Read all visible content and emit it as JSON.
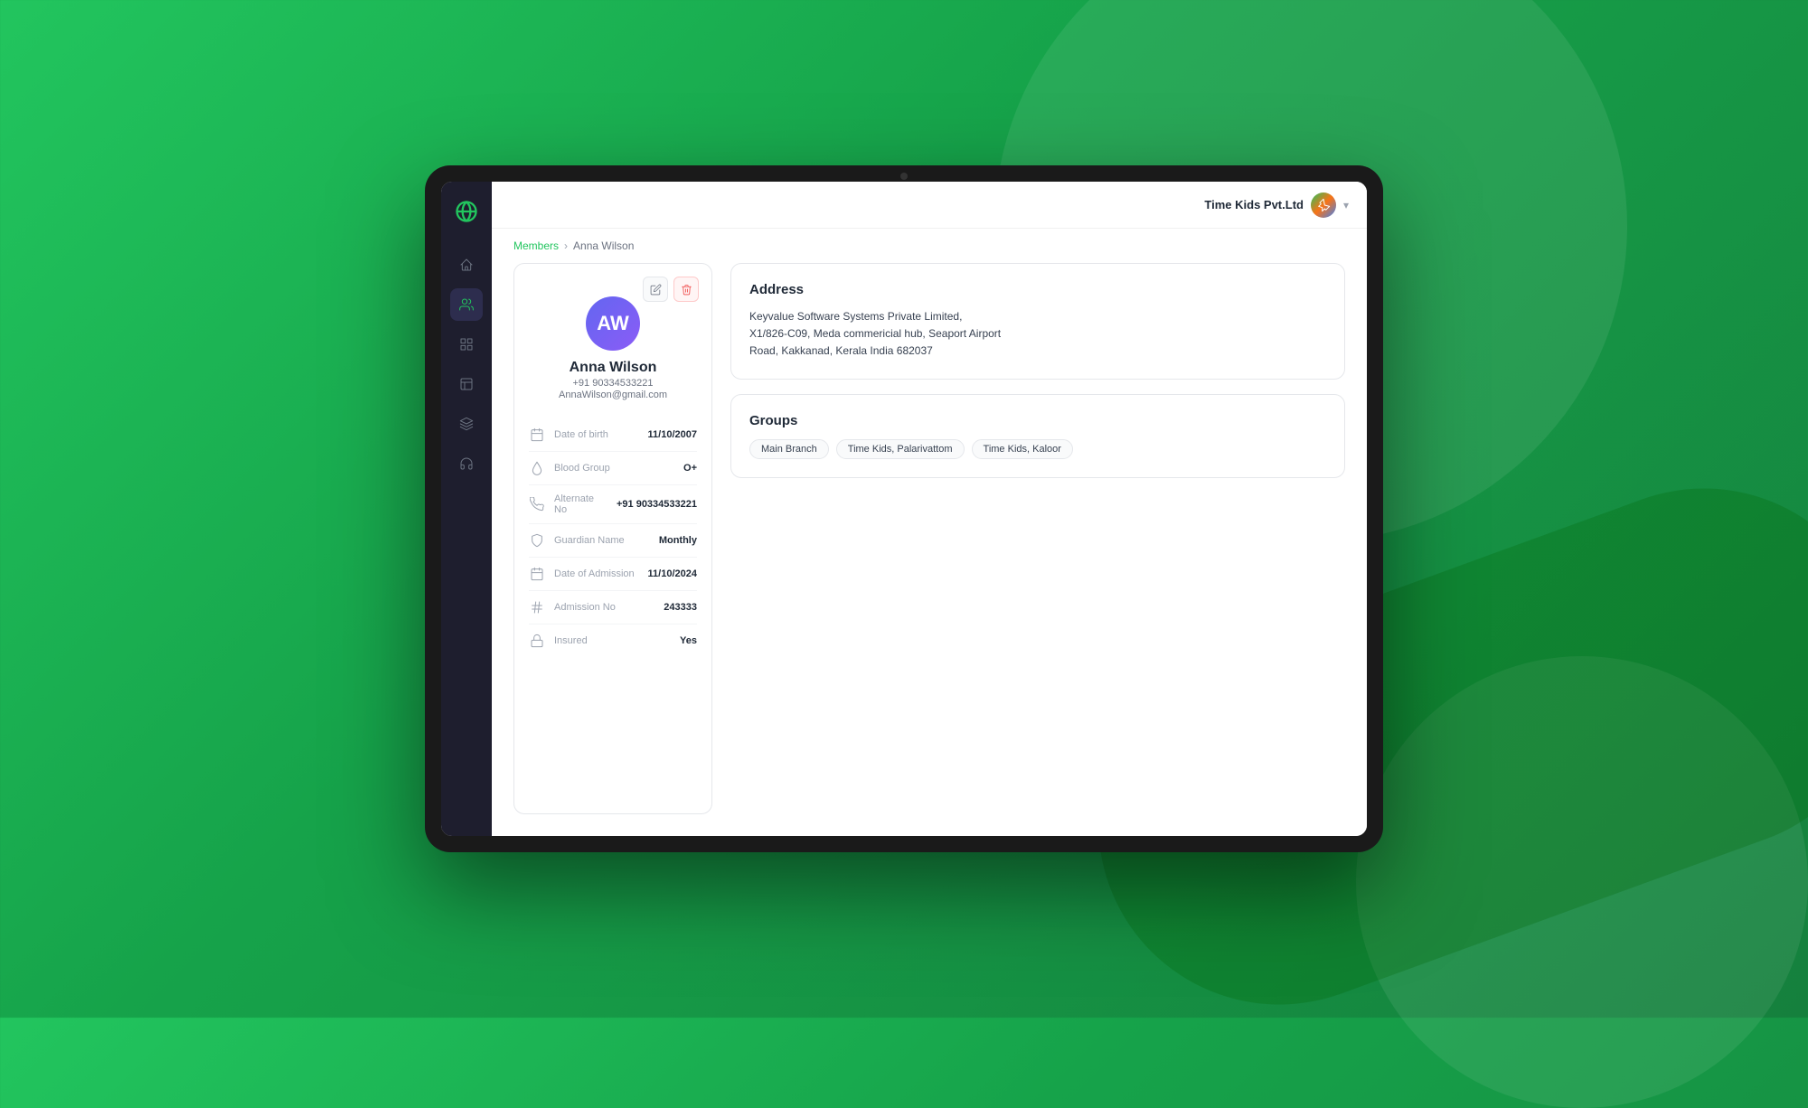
{
  "app": {
    "org_name": "Time Kids Pvt.Ltd"
  },
  "breadcrumb": {
    "parent": "Members",
    "separator": ">",
    "current": "Anna Wilson"
  },
  "profile": {
    "name": "Anna Wilson",
    "phone": "+91 90334533221",
    "email": "AnnaWilson@gmail.com",
    "edit_label": "✏",
    "delete_label": "🗑",
    "initials": "AW"
  },
  "info_fields": [
    {
      "icon": "calendar",
      "label": "Date of birth",
      "value": "11/10/2007"
    },
    {
      "icon": "blood",
      "label": "Blood Group",
      "value": "O+"
    },
    {
      "icon": "phone",
      "label": "Alternate No",
      "value": "+91 90334533221"
    },
    {
      "icon": "shield",
      "label": "Guardian Name",
      "value": "Monthly"
    },
    {
      "icon": "calendar2",
      "label": "Date of Admission",
      "value": "11/10/2024"
    },
    {
      "icon": "hash",
      "label": "Admission No",
      "value": "243333"
    },
    {
      "icon": "lock",
      "label": "Insured",
      "value": "Yes"
    }
  ],
  "address": {
    "title": "Address",
    "line1": "Keyvalue Software Systems Private Limited,",
    "line2": "X1/826-C09, Meda commericial hub, Seaport Airport",
    "line3": "Road, Kakkanad, Kerala India 682037"
  },
  "groups": {
    "title": "Groups",
    "items": [
      {
        "label": "Main Branch"
      },
      {
        "label": "Time Kids, Palarivattom"
      },
      {
        "label": "Time Kids, Kaloor"
      }
    ]
  },
  "sidebar": {
    "items": [
      {
        "icon": "home",
        "active": false
      },
      {
        "icon": "users",
        "active": true
      },
      {
        "icon": "grid",
        "active": false
      },
      {
        "icon": "chart",
        "active": false
      },
      {
        "icon": "layers",
        "active": false
      },
      {
        "icon": "headset",
        "active": false
      }
    ]
  }
}
